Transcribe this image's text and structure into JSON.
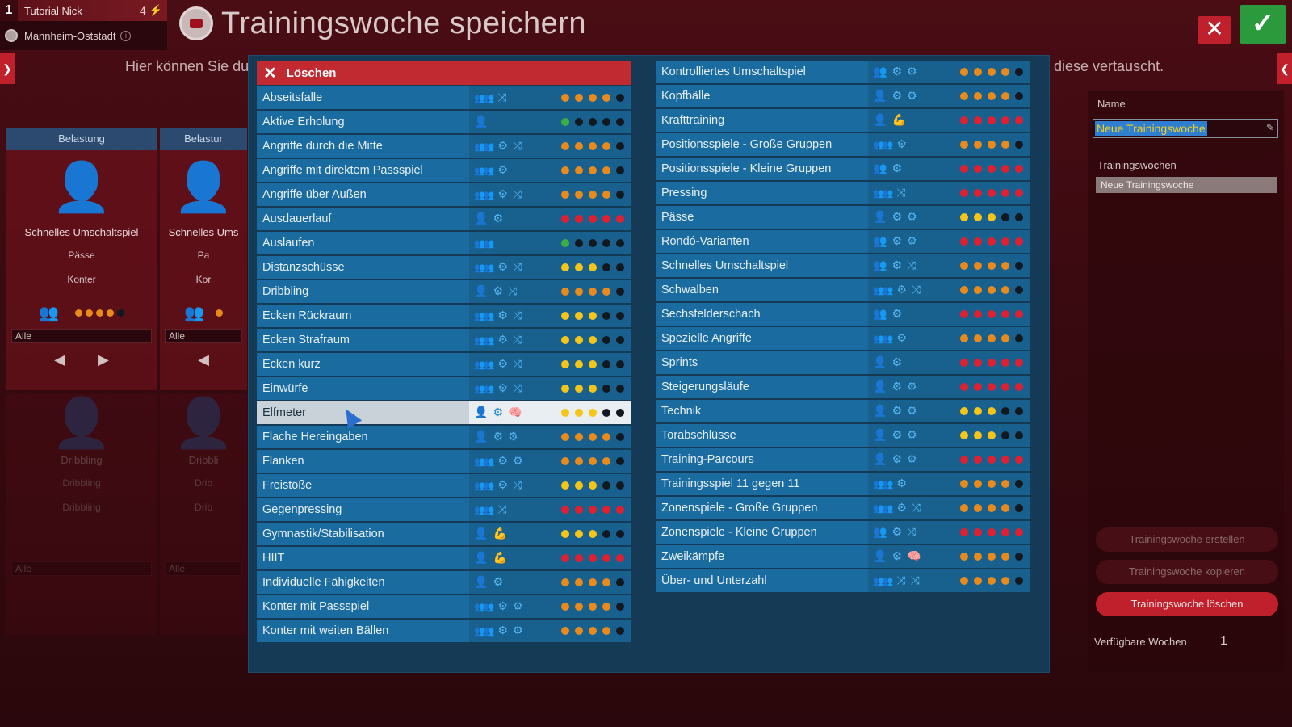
{
  "manager": {
    "number": "1",
    "name": "Tutorial Nick",
    "count": "4",
    "club": "Mannheim-Oststadt"
  },
  "page_title": "Trainingswoche speichern",
  "subtitle_left": "Hier können Sie du",
  "subtitle_right": "n diese vertauscht.",
  "buttons": {
    "close": "✕",
    "confirm": "✓"
  },
  "bg_cards": [
    {
      "header": "Belastung",
      "name": "Schnelles Umschaltspiel",
      "attr1": "Pässe",
      "attr2": "Konter",
      "select": "Alle"
    },
    {
      "header": "Belastur",
      "name": "Schnelles Ums",
      "attr1": "Pa",
      "attr2": "Kor",
      "select": "Alle"
    },
    {
      "header": "",
      "name": "Dribbling",
      "attr1": "Dribbling",
      "attr2": "Dribbling",
      "select": "Alle"
    },
    {
      "header": "",
      "name": "Dribbli",
      "attr1": "Drib",
      "attr2": "Drib",
      "select": "Alle"
    }
  ],
  "delete_label": "Löschen",
  "left_exercises": [
    {
      "name": "Abseitsfalle",
      "icons": [
        "team",
        "split"
      ],
      "dots": [
        "#e88a1c",
        "#e88a1c",
        "#e88a1c",
        "#e88a1c",
        "#111820"
      ]
    },
    {
      "name": "Aktive Erholung",
      "icons": [
        "person"
      ],
      "dots": [
        "#3cb043",
        "#111820",
        "#111820",
        "#111820",
        "#111820"
      ]
    },
    {
      "name": "Angriffe durch die Mitte",
      "icons": [
        "team",
        "gear",
        "split"
      ],
      "dots": [
        "#e88a1c",
        "#e88a1c",
        "#e88a1c",
        "#e88a1c",
        "#111820"
      ]
    },
    {
      "name": "Angriffe mit direktem Passspiel",
      "icons": [
        "team",
        "gear"
      ],
      "dots": [
        "#e88a1c",
        "#e88a1c",
        "#e88a1c",
        "#e88a1c",
        "#111820"
      ]
    },
    {
      "name": "Angriffe über Außen",
      "icons": [
        "team",
        "gear",
        "split"
      ],
      "dots": [
        "#e88a1c",
        "#e88a1c",
        "#e88a1c",
        "#e88a1c",
        "#111820"
      ]
    },
    {
      "name": "Ausdauerlauf",
      "icons": [
        "person",
        "gear"
      ],
      "dots": [
        "#e02030",
        "#e02030",
        "#e02030",
        "#e02030",
        "#e02030"
      ]
    },
    {
      "name": "Auslaufen",
      "icons": [
        "team"
      ],
      "dots": [
        "#3cb043",
        "#111820",
        "#111820",
        "#111820",
        "#111820"
      ]
    },
    {
      "name": "Distanzschüsse",
      "icons": [
        "team",
        "gear",
        "split"
      ],
      "dots": [
        "#f5c518",
        "#f5c518",
        "#f5c518",
        "#111820",
        "#111820"
      ]
    },
    {
      "name": "Dribbling",
      "icons": [
        "person",
        "gear",
        "split"
      ],
      "dots": [
        "#e88a1c",
        "#e88a1c",
        "#e88a1c",
        "#e88a1c",
        "#111820"
      ]
    },
    {
      "name": "Ecken Rückraum",
      "icons": [
        "team",
        "gear",
        "split"
      ],
      "dots": [
        "#f5c518",
        "#f5c518",
        "#f5c518",
        "#111820",
        "#111820"
      ]
    },
    {
      "name": "Ecken Strafraum",
      "icons": [
        "team",
        "gear",
        "split"
      ],
      "dots": [
        "#f5c518",
        "#f5c518",
        "#f5c518",
        "#111820",
        "#111820"
      ]
    },
    {
      "name": "Ecken kurz",
      "icons": [
        "team",
        "gear",
        "split"
      ],
      "dots": [
        "#f5c518",
        "#f5c518",
        "#f5c518",
        "#111820",
        "#111820"
      ]
    },
    {
      "name": "Einwürfe",
      "icons": [
        "team",
        "gear",
        "split"
      ],
      "dots": [
        "#f5c518",
        "#f5c518",
        "#f5c518",
        "#111820",
        "#111820"
      ]
    },
    {
      "name": "Elfmeter",
      "icons": [
        "person",
        "gear",
        "brain"
      ],
      "dots": [
        "#f5c518",
        "#f5c518",
        "#f5c518",
        "#111820",
        "#111820"
      ],
      "selected": true
    },
    {
      "name": "Flache Hereingaben",
      "icons": [
        "person",
        "gear",
        "gear"
      ],
      "dots": [
        "#e88a1c",
        "#e88a1c",
        "#e88a1c",
        "#e88a1c",
        "#111820"
      ]
    },
    {
      "name": "Flanken",
      "icons": [
        "team",
        "gear",
        "gear"
      ],
      "dots": [
        "#e88a1c",
        "#e88a1c",
        "#e88a1c",
        "#e88a1c",
        "#111820"
      ]
    },
    {
      "name": "Freistöße",
      "icons": [
        "team",
        "gear",
        "split"
      ],
      "dots": [
        "#f5c518",
        "#f5c518",
        "#f5c518",
        "#111820",
        "#111820"
      ]
    },
    {
      "name": "Gegenpressing",
      "icons": [
        "team",
        "split"
      ],
      "dots": [
        "#e02030",
        "#e02030",
        "#e02030",
        "#e02030",
        "#e02030"
      ]
    },
    {
      "name": "Gymnastik/Stabilisation",
      "icons": [
        "person",
        "muscle"
      ],
      "dots": [
        "#f5c518",
        "#f5c518",
        "#f5c518",
        "#111820",
        "#111820"
      ]
    },
    {
      "name": "HIIT",
      "icons": [
        "person",
        "muscle"
      ],
      "dots": [
        "#e02030",
        "#e02030",
        "#e02030",
        "#e02030",
        "#e02030"
      ]
    },
    {
      "name": "Individuelle Fähigkeiten",
      "icons": [
        "person",
        "gear"
      ],
      "dots": [
        "#e88a1c",
        "#e88a1c",
        "#e88a1c",
        "#e88a1c",
        "#111820"
      ]
    },
    {
      "name": "Konter mit Passspiel",
      "icons": [
        "team",
        "gear",
        "gear"
      ],
      "dots": [
        "#e88a1c",
        "#e88a1c",
        "#e88a1c",
        "#e88a1c",
        "#111820"
      ]
    },
    {
      "name": "Konter mit weiten Bällen",
      "icons": [
        "team",
        "gear",
        "gear"
      ],
      "dots": [
        "#e88a1c",
        "#e88a1c",
        "#e88a1c",
        "#e88a1c",
        "#111820"
      ]
    }
  ],
  "right_exercises": [
    {
      "name": "Kontrolliertes Umschaltspiel",
      "icons": [
        "group",
        "gear",
        "gear"
      ],
      "dots": [
        "#e88a1c",
        "#e88a1c",
        "#e88a1c",
        "#e88a1c",
        "#111820"
      ]
    },
    {
      "name": "Kopfbälle",
      "icons": [
        "person",
        "gear",
        "gear"
      ],
      "dots": [
        "#e88a1c",
        "#e88a1c",
        "#e88a1c",
        "#e88a1c",
        "#111820"
      ]
    },
    {
      "name": "Krafttraining",
      "icons": [
        "person",
        "muscle"
      ],
      "dots": [
        "#e02030",
        "#e02030",
        "#e02030",
        "#e02030",
        "#e02030"
      ]
    },
    {
      "name": "Positionsspiele - Große Gruppen",
      "icons": [
        "team",
        "gear"
      ],
      "dots": [
        "#e88a1c",
        "#e88a1c",
        "#e88a1c",
        "#e88a1c",
        "#111820"
      ]
    },
    {
      "name": "Positionsspiele - Kleine Gruppen",
      "icons": [
        "group",
        "gear"
      ],
      "dots": [
        "#e02030",
        "#e02030",
        "#e02030",
        "#e02030",
        "#e02030"
      ]
    },
    {
      "name": "Pressing",
      "icons": [
        "team",
        "split"
      ],
      "dots": [
        "#e02030",
        "#e02030",
        "#e02030",
        "#e02030",
        "#e02030"
      ]
    },
    {
      "name": "Pässe",
      "icons": [
        "person",
        "gear",
        "gear"
      ],
      "dots": [
        "#f5c518",
        "#f5c518",
        "#f5c518",
        "#111820",
        "#111820"
      ]
    },
    {
      "name": "Rondó-Varianten",
      "icons": [
        "group",
        "gear",
        "gear"
      ],
      "dots": [
        "#e02030",
        "#e02030",
        "#e02030",
        "#e02030",
        "#e02030"
      ]
    },
    {
      "name": "Schnelles Umschaltspiel",
      "icons": [
        "group",
        "gear",
        "split"
      ],
      "dots": [
        "#e88a1c",
        "#e88a1c",
        "#e88a1c",
        "#e88a1c",
        "#111820"
      ]
    },
    {
      "name": "Schwalben",
      "icons": [
        "team",
        "gear",
        "split"
      ],
      "dots": [
        "#e88a1c",
        "#e88a1c",
        "#e88a1c",
        "#e88a1c",
        "#111820"
      ]
    },
    {
      "name": "Sechsfelderschach",
      "icons": [
        "group",
        "gear"
      ],
      "dots": [
        "#e02030",
        "#e02030",
        "#e02030",
        "#e02030",
        "#e02030"
      ]
    },
    {
      "name": "Spezielle Angriffe",
      "icons": [
        "team",
        "gear"
      ],
      "dots": [
        "#e88a1c",
        "#e88a1c",
        "#e88a1c",
        "#e88a1c",
        "#111820"
      ]
    },
    {
      "name": "Sprints",
      "icons": [
        "person",
        "gear"
      ],
      "dots": [
        "#e02030",
        "#e02030",
        "#e02030",
        "#e02030",
        "#e02030"
      ]
    },
    {
      "name": "Steigerungsläufe",
      "icons": [
        "person",
        "gear",
        "gear"
      ],
      "dots": [
        "#e02030",
        "#e02030",
        "#e02030",
        "#e02030",
        "#e02030"
      ]
    },
    {
      "name": "Technik",
      "icons": [
        "person",
        "gear",
        "gear"
      ],
      "dots": [
        "#f5c518",
        "#f5c518",
        "#f5c518",
        "#111820",
        "#111820"
      ]
    },
    {
      "name": "Torabschlüsse",
      "icons": [
        "person",
        "gear",
        "gear"
      ],
      "dots": [
        "#f5c518",
        "#f5c518",
        "#f5c518",
        "#111820",
        "#111820"
      ]
    },
    {
      "name": "Training-Parcours",
      "icons": [
        "person",
        "gear",
        "gear"
      ],
      "dots": [
        "#e02030",
        "#e02030",
        "#e02030",
        "#e02030",
        "#e02030"
      ]
    },
    {
      "name": "Trainingsspiel 11 gegen 11",
      "icons": [
        "team",
        "gear"
      ],
      "dots": [
        "#e88a1c",
        "#e88a1c",
        "#e88a1c",
        "#e88a1c",
        "#111820"
      ]
    },
    {
      "name": "Zonenspiele - Große Gruppen",
      "icons": [
        "team",
        "gear",
        "split"
      ],
      "dots": [
        "#e88a1c",
        "#e88a1c",
        "#e88a1c",
        "#e88a1c",
        "#111820"
      ]
    },
    {
      "name": "Zonenspiele - Kleine Gruppen",
      "icons": [
        "group",
        "gear",
        "split"
      ],
      "dots": [
        "#e02030",
        "#e02030",
        "#e02030",
        "#e02030",
        "#e02030"
      ]
    },
    {
      "name": "Zweikämpfe",
      "icons": [
        "person",
        "gear",
        "brain"
      ],
      "dots": [
        "#e88a1c",
        "#e88a1c",
        "#e88a1c",
        "#e88a1c",
        "#111820"
      ]
    },
    {
      "name": "Über- und Unterzahl",
      "icons": [
        "team",
        "split",
        "split"
      ],
      "dots": [
        "#e88a1c",
        "#e88a1c",
        "#e88a1c",
        "#e88a1c",
        "#111820"
      ]
    }
  ],
  "right_panel": {
    "name_label": "Name",
    "name_value": "Neue Trainingswoche",
    "weeks_label": "Trainingswochen",
    "weeks": [
      "Neue Trainingswoche"
    ],
    "btn_create": "Trainingswoche erstellen",
    "btn_copy": "Trainingswoche kopieren",
    "btn_delete": "Trainingswoche löschen",
    "available_label": "Verfügbare Wochen",
    "available_value": "1"
  },
  "colors": {
    "accent_red": "#c0202c",
    "accent_green": "#2b9a3c",
    "row_blue": "#1a6ba0"
  }
}
